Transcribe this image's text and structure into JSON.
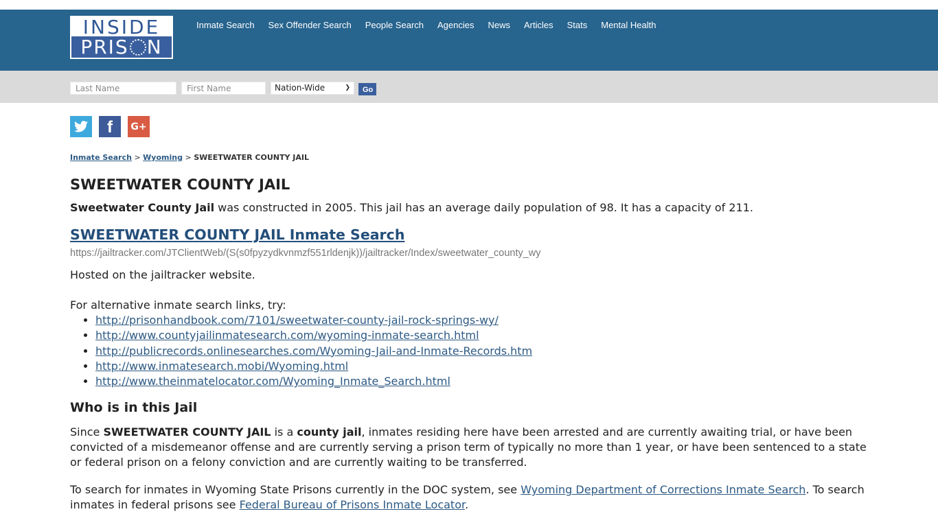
{
  "site": {
    "logo_line1": "INSIDE",
    "logo_line2_a": "PRIS",
    "logo_line2_b": "N",
    "colors": {
      "header": "#27648e",
      "searchbar": "#dadada",
      "link": "#2d5a84",
      "go_button": "#3a5f9e"
    }
  },
  "nav": {
    "items": [
      {
        "label": "Inmate Search"
      },
      {
        "label": "Sex Offender Search"
      },
      {
        "label": "People Search"
      },
      {
        "label": "Agencies"
      },
      {
        "label": "News"
      },
      {
        "label": "Articles"
      },
      {
        "label": "Stats"
      },
      {
        "label": "Mental Health"
      }
    ]
  },
  "search": {
    "last_name_placeholder": "Last Name",
    "first_name_placeholder": "First Name",
    "scope_selected": "Nation-Wide",
    "go_label": "Go"
  },
  "social": {
    "twitter": "twitter-icon",
    "facebook_glyph": "f",
    "googleplus_glyph": "G+"
  },
  "breadcrumb": {
    "items": [
      "Inmate Search",
      "Wyoming"
    ],
    "separator": ">",
    "current": "SWEETWATER COUNTY JAIL"
  },
  "page": {
    "title": "SWEETWATER COUNTY JAIL",
    "lead_bold": "Sweetwater County Jail",
    "lead_rest": " was constructed in 2005. This jail has an average daily population of 98. It has a capacity of 211.",
    "search_link": "SWEETWATER COUNTY JAIL Inmate Search",
    "search_url": "https://jailtracker.com/JTClientWeb/(S(s0fpyzydkvnmzf551rldenjk))/jailtracker/Index/sweetwater_county_wy",
    "hosted": "Hosted on the jailtracker website.",
    "alt_intro": "For alternative inmate search links, try:",
    "alt_links": [
      "http://prisonhandbook.com/7101/sweetwater-county-jail-rock-springs-wy/",
      "http://www.countyjailinmatesearch.com/wyoming-inmate-search.html",
      "http://publicrecords.onlinesearches.com/Wyoming-Jail-and-Inmate-Records.htm",
      "http://www.inmatesearch.mobi/Wyoming.html",
      "http://www.theinmatelocator.com/Wyoming_Inmate_Search.html"
    ],
    "who_heading": "Who is in this Jail",
    "who_p1_a": "Since ",
    "who_p1_b": "SWEETWATER COUNTY JAIL",
    "who_p1_c": " is a ",
    "who_p1_d": "county jail",
    "who_p1_e": ", inmates residing here have been arrested and are currently awaiting trial, or have been convicted of a misdemeanor offense and are currently serving a prison term of typically no more than 1 year, or have been sentenced to a state or federal prison on a felony conviction and are currently waiting to be transferred.",
    "who_p2_a": "To search for inmates in Wyoming State Prisons currently in the DOC system, see ",
    "who_p2_link1": "Wyoming Department of Corrections Inmate Search",
    "who_p2_b": ". To search inmates in federal prisons see ",
    "who_p2_link2": "Federal Bureau of Prisons Inmate Locator",
    "who_p2_c": "."
  }
}
